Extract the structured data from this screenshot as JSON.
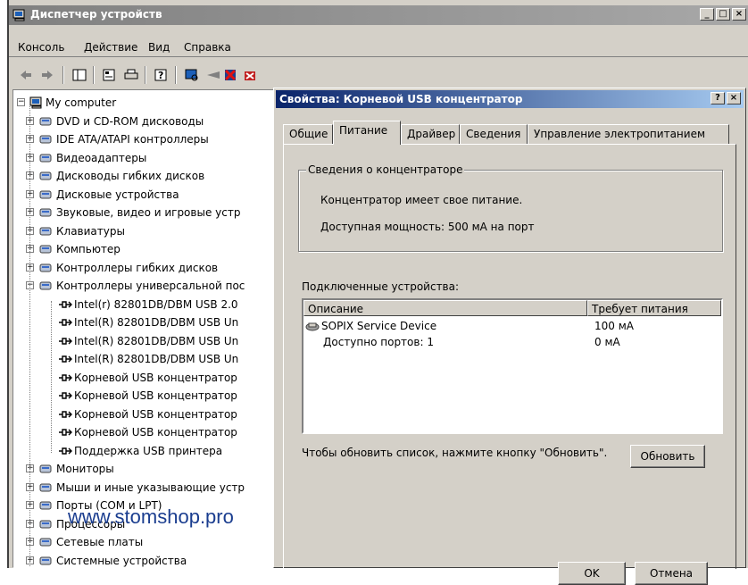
{
  "window": {
    "title": "Диспетчер устройств",
    "caption_buttons": [
      "_",
      "□",
      "×"
    ]
  },
  "menu": [
    "Консоль",
    "Действие",
    "Вид",
    "Справка"
  ],
  "toolbar": {
    "icons": [
      "back-arrow-icon",
      "forward-arrow-icon",
      "show-hide-tree-icon",
      "properties-icon",
      "print-icon",
      "help-icon",
      "scan-hardware-icon",
      "update-driver-icon",
      "uninstall-icon",
      "disable-icon"
    ]
  },
  "tree": {
    "root": "My computer",
    "categories": [
      "DVD и CD-ROM дисководы",
      "IDE ATA/ATAPI контроллеры",
      "Видеоадаптеры",
      "Дисководы гибких дисков",
      "Дисковые устройства",
      "Звуковые, видео и игровые устр",
      "Клавиатуры",
      "Компьютер",
      "Контроллеры гибких дисков",
      "Контроллеры универсальной пос"
    ],
    "usb_children": [
      "Intel(r) 82801DB/DBM USB 2.0",
      "Intel(R) 82801DB/DBM USB Un",
      "Intel(R) 82801DB/DBM USB Un",
      "Intel(R) 82801DB/DBM USB Un",
      "Корневой USB концентратор",
      "Корневой USB концентратор",
      "Корневой USB концентратор",
      "Корневой USB концентратор",
      "Поддержка USB принтера"
    ],
    "categories_after": [
      "Мониторы",
      "Мыши и иные указывающие устр",
      "Порты (COM и LPT)",
      "Процессоры",
      "Сетевые платы",
      "Системные устройства"
    ]
  },
  "watermark": "www.stomshop.pro",
  "dialog": {
    "title": "Свойства: Корневой USB концентратор",
    "caption_buttons": [
      "?",
      "×"
    ],
    "tabs": [
      "Общие",
      "Питание",
      "Драйвер",
      "Сведения",
      "Управление электропитанием"
    ],
    "active_tab": "Питание",
    "hub_info": {
      "legend": "Сведения о концентраторе",
      "self_powered": "Концентратор имеет свое питание.",
      "available_power": "Доступная мощность:  500 мА на порт"
    },
    "connected_label": "Подключенные устройства:",
    "columns": [
      "Описание",
      "Требует питания"
    ],
    "rows": [
      {
        "description": "SOPIX Service Device",
        "power": "100 мА"
      },
      {
        "description": "Доступно портов: 1",
        "power": "0 мА"
      }
    ],
    "hint": "Чтобы обновить список, нажмите кнопку \"Обновить\".",
    "refresh_button": "Обновить",
    "ok_button": "OK",
    "cancel_button": "Отмена"
  }
}
